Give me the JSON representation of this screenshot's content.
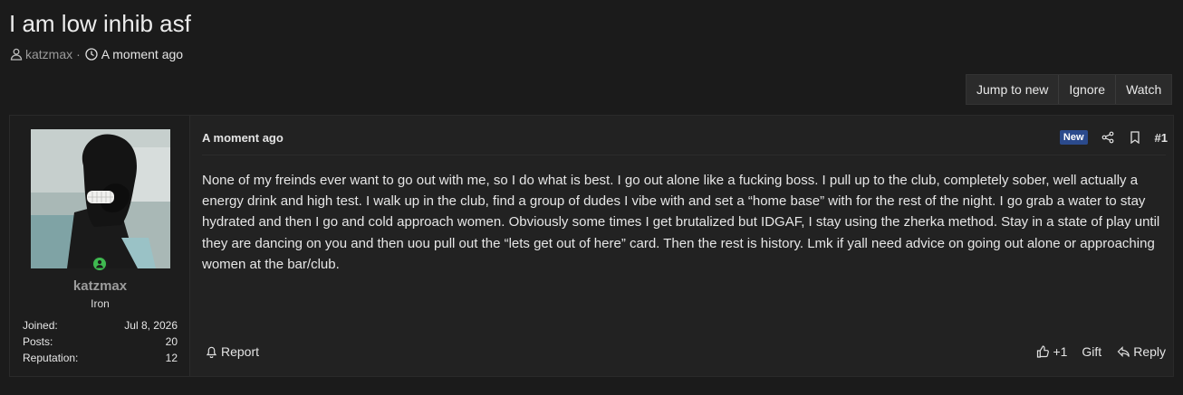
{
  "thread": {
    "title": "I am low inhib asf",
    "author": "katzmax",
    "separator": "·",
    "time": "A moment ago"
  },
  "actions": {
    "jump_to_new": "Jump to new",
    "ignore": "Ignore",
    "watch": "Watch"
  },
  "user": {
    "name": "katzmax",
    "title": "Iron",
    "stats": {
      "joined_label": "Joined:",
      "joined_value": "Jul 8, 2026",
      "posts_label": "Posts:",
      "posts_value": "20",
      "reputation_label": "Reputation:",
      "reputation_value": "12"
    }
  },
  "post": {
    "date": "A moment ago",
    "badge": "New",
    "number": "#1",
    "body": "None of my freinds ever want to go out with me, so I do what is best. I go out alone like a fucking boss. I pull up to the club, completely sober, well actually a energy drink and high test. I walk up in the club, find a group of dudes I vibe with and set a “home base” with for the rest of the night. I go grab a water to stay hydrated and then I go and cold approach women. Obviously some times I get brutalized but IDGAF, I stay using the zherka method. Stay in a state of play until they are dancing on you and then uou pull out the “lets get out of here” card. Then the rest is history. Lmk if yall need advice on going out alone or approaching women at the bar/club.",
    "report_label": "Report",
    "like_count": "+1",
    "gift_label": "Gift",
    "reply_label": "Reply"
  },
  "colors": {
    "background": "#1b1b1b",
    "panel": "#222222",
    "badge_new": "#2b4a8c",
    "online": "#3fb950"
  }
}
